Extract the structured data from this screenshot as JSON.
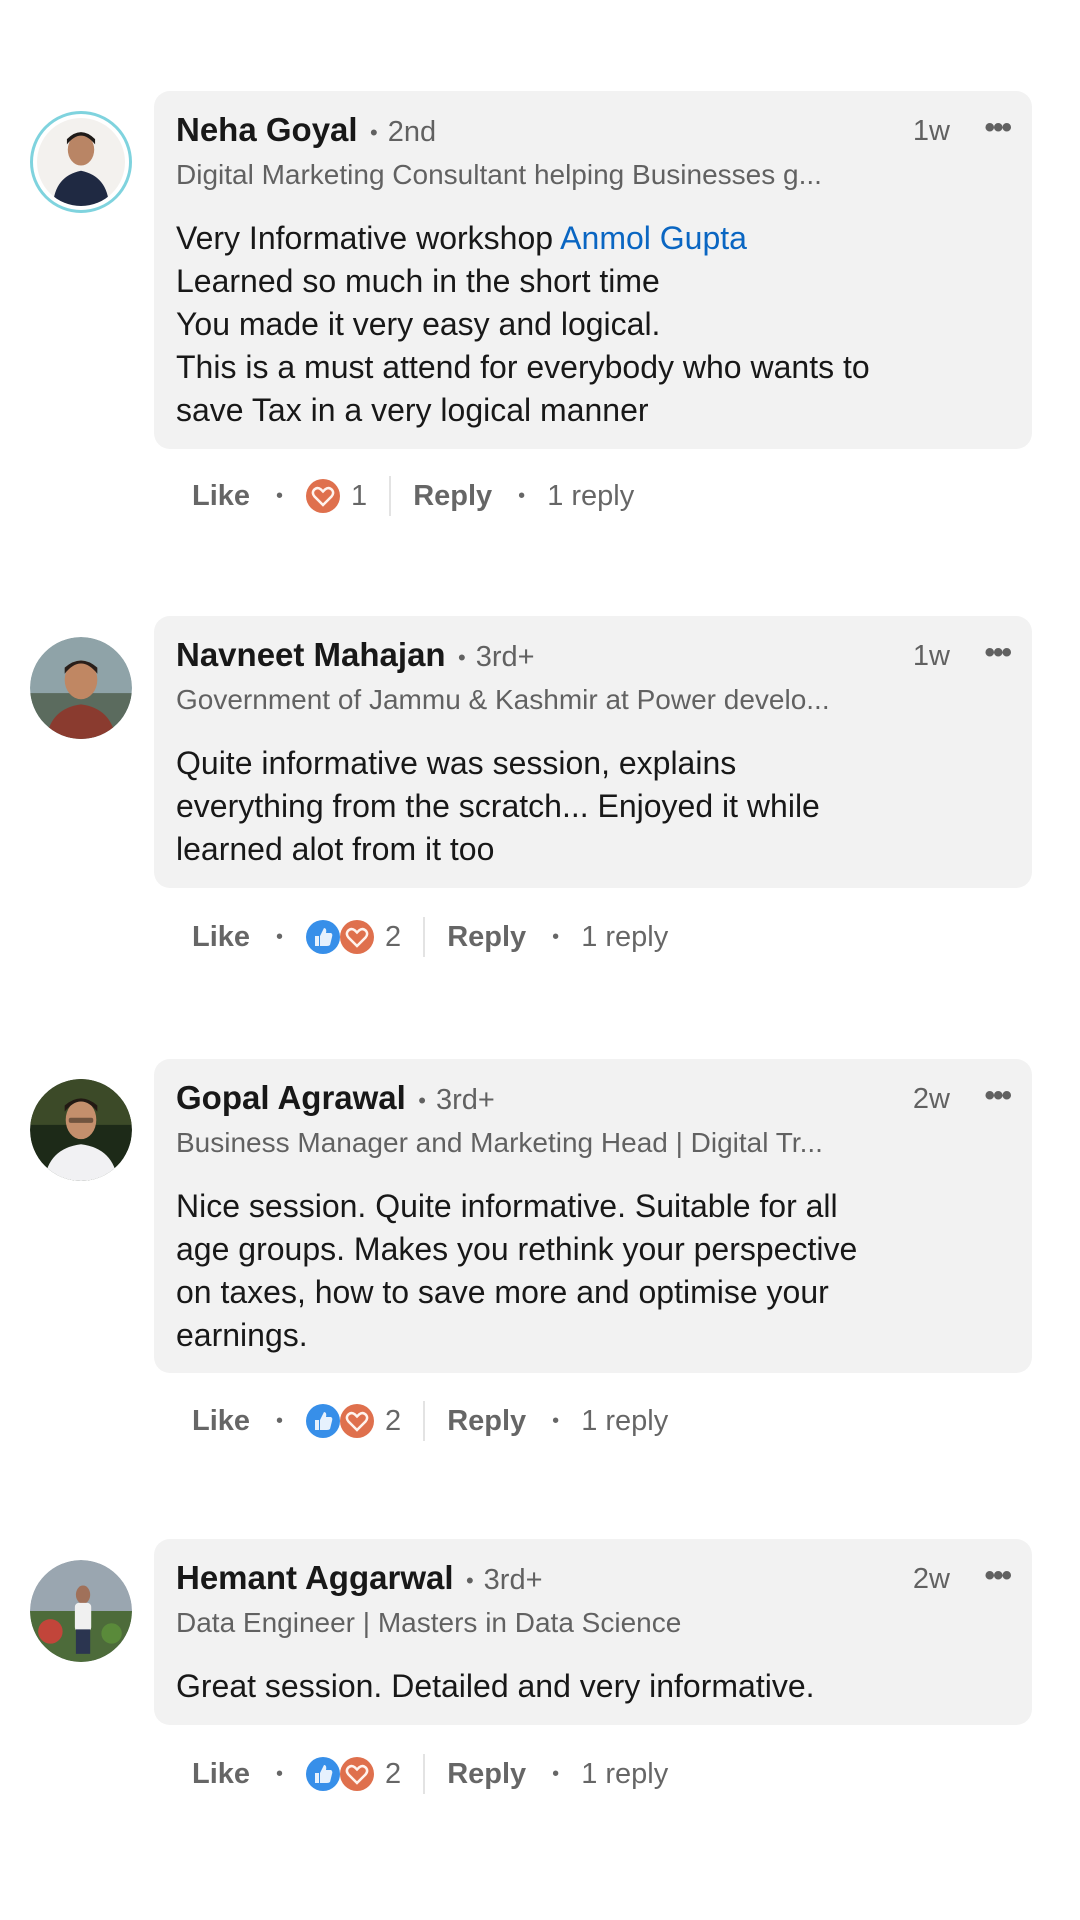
{
  "comments": [
    {
      "name": "Neha Goyal",
      "degree": "2nd",
      "headline": "Digital Marketing Consultant helping Businesses g...",
      "time": "1w",
      "body_before_mention": "Very Informative  workshop ",
      "mention": "Anmol Gupta",
      "body_lines": [
        "Learned so much in the short time",
        "You made it very easy and logical.",
        "This is a must attend for everybody who wants to",
        "save Tax in a very logical manner"
      ],
      "like_label": "Like",
      "reaction_icons": [
        "love-icon"
      ],
      "reaction_count": "1",
      "reply_label": "Reply",
      "replies_label": "1 reply"
    },
    {
      "name": "Navneet Mahajan",
      "degree": "3rd+",
      "headline": "Government of Jammu & Kashmir at Power develo...",
      "time": "1w",
      "body_lines": [
        "Quite informative was session, explains",
        "everything from the scratch... Enjoyed it while",
        "learned alot from it too"
      ],
      "like_label": "Like",
      "reaction_icons": [
        "like-icon",
        "love-icon"
      ],
      "reaction_count": "2",
      "reply_label": "Reply",
      "replies_label": "1 reply"
    },
    {
      "name": "Gopal Agrawal",
      "degree": "3rd+",
      "headline": "Business Manager and Marketing Head | Digital Tr...",
      "time": "2w",
      "body_lines": [
        "Nice session. Quite informative. Suitable for all",
        "age groups. Makes you rethink your perspective",
        "on taxes, how to save more and optimise your",
        "earnings."
      ],
      "like_label": "Like",
      "reaction_icons": [
        "like-icon",
        "love-icon"
      ],
      "reaction_count": "2",
      "reply_label": "Reply",
      "replies_label": "1 reply"
    },
    {
      "name": "Hemant Aggarwal",
      "degree": "3rd+",
      "headline": "Data Engineer | Masters in Data Science",
      "time": "2w",
      "body_lines": [
        "Great session. Detailed and very informative."
      ],
      "like_label": "Like",
      "reaction_icons": [
        "like-icon",
        "love-icon"
      ],
      "reaction_count": "2",
      "reply_label": "Reply",
      "replies_label": "1 reply"
    }
  ],
  "dot": "•",
  "more_glyph": "•••",
  "colors": {
    "mention": "#0a66c2",
    "bubble_bg": "#f2f2f2",
    "like_reaction": "#378fe9",
    "love_reaction": "#df704d"
  }
}
